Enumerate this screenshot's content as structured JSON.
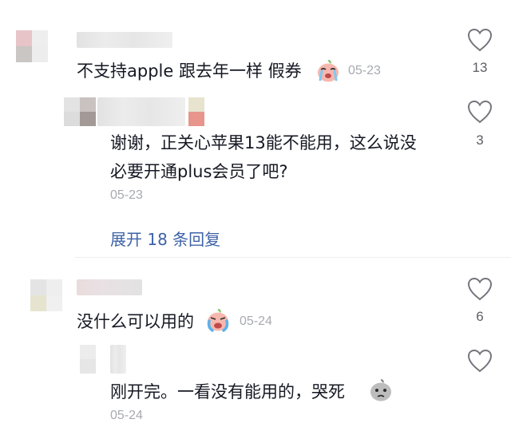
{
  "comments": [
    {
      "text": "不支持apple 跟去年一样 假券",
      "date": "05-23",
      "likes": "13"
    },
    {
      "text_line1": "谢谢，正关心苹果13能不能用，这么说没",
      "text_line2": "必要开通plus会员了吧?",
      "date": "05-23",
      "likes": "3"
    },
    {
      "text": "没什么可以用的",
      "date": "05-24",
      "likes": "6"
    },
    {
      "text": "刚开完。一看没有能用的，哭死",
      "date": "05-24",
      "likes": ""
    }
  ],
  "expand_label": "展开 18 条回复",
  "icons": [
    "heart-outline-icon",
    "tearful-face-emoji",
    "crying-face-emoji"
  ],
  "colors": {
    "text": "#161823",
    "date": "#a8aab0",
    "link": "#3e63a7",
    "divider": "#eeeeee"
  }
}
